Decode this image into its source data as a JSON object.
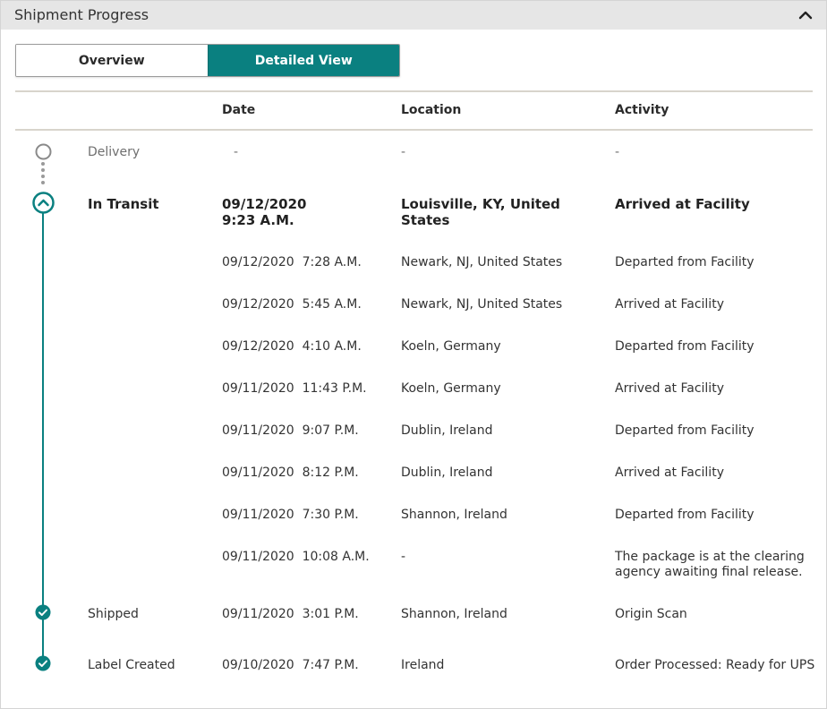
{
  "panel": {
    "title": "Shipment Progress"
  },
  "toggle": {
    "overview_label": "Overview",
    "detailed_label": "Detailed View",
    "selected": "Detailed View"
  },
  "columns": {
    "date": "Date",
    "location": "Location",
    "activity": "Activity"
  },
  "rows": [
    {
      "status": "Delivery",
      "date": "-",
      "location": "-",
      "activity": "-"
    },
    {
      "status": "In Transit",
      "date": "09/12/2020\n9:23 A.M.",
      "location": "Louisville, KY, United\nStates",
      "activity": "Arrived at Facility"
    },
    {
      "status": "",
      "date": "09/12/2020  7:28 A.M.",
      "location": "Newark, NJ, United States",
      "activity": "Departed from Facility"
    },
    {
      "status": "",
      "date": "09/12/2020  5:45 A.M.",
      "location": "Newark, NJ, United States",
      "activity": "Arrived at Facility"
    },
    {
      "status": "",
      "date": "09/12/2020  4:10 A.M.",
      "location": "Koeln, Germany",
      "activity": "Departed from Facility"
    },
    {
      "status": "",
      "date": "09/11/2020  11:43 P.M.",
      "location": "Koeln, Germany",
      "activity": "Arrived at Facility"
    },
    {
      "status": "",
      "date": "09/11/2020  9:07 P.M.",
      "location": "Dublin, Ireland",
      "activity": "Departed from Facility"
    },
    {
      "status": "",
      "date": "09/11/2020  8:12 P.M.",
      "location": "Dublin, Ireland",
      "activity": "Arrived at Facility"
    },
    {
      "status": "",
      "date": "09/11/2020  7:30 P.M.",
      "location": "Shannon, Ireland",
      "activity": "Departed from Facility"
    },
    {
      "status": "",
      "date": "09/11/2020  10:08 A.M.",
      "location": "-",
      "activity": "The package is at the clearing\nagency awaiting final release."
    },
    {
      "status": "Shipped",
      "date": "09/11/2020  3:01 P.M.",
      "location": "Shannon, Ireland",
      "activity": "Origin Scan"
    },
    {
      "status": "Label Created",
      "date": "09/10/2020  7:47 P.M.",
      "location": "Ireland",
      "activity": "Order Processed: Ready for UPS"
    }
  ],
  "icons": {
    "collapse": "chevron-up-icon",
    "delivery_node": "empty-circle-icon",
    "in_transit_node": "chevron-up-circle-icon",
    "completed_node": "check-circle-icon"
  },
  "colors": {
    "accent": "#0a8080",
    "header_bg": "#e6e6e6",
    "muted_text": "#6f6f6f"
  }
}
